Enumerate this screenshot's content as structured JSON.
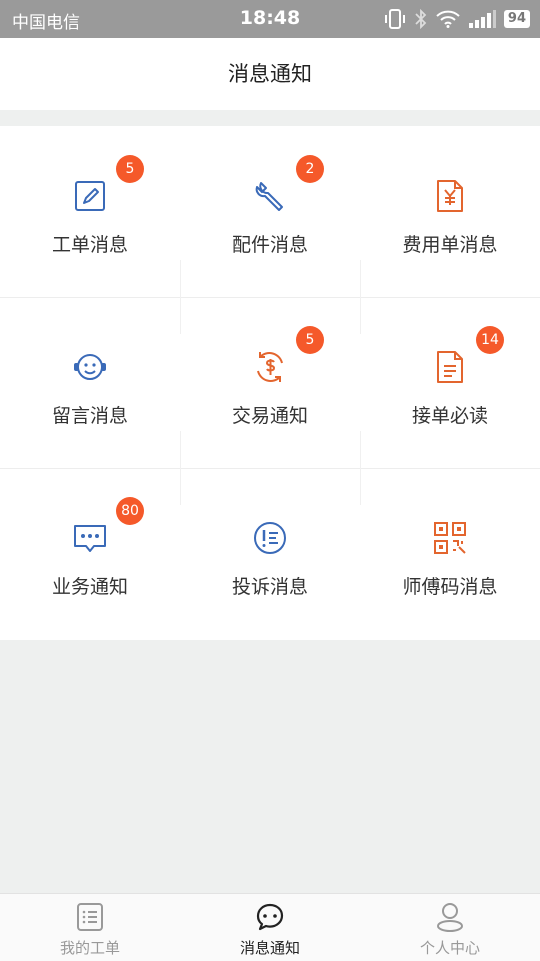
{
  "status_bar": {
    "carrier": "中国电信",
    "time": "18:48",
    "battery": "94"
  },
  "header": {
    "title": "消息通知"
  },
  "colors": {
    "accent_orange": "#e3652e",
    "accent_blue": "#3a6ab8",
    "badge": "#f5592a"
  },
  "grid": {
    "items": [
      {
        "label": "工单消息",
        "icon": "edit-icon",
        "badge": "5"
      },
      {
        "label": "配件消息",
        "icon": "wrench-icon",
        "badge": "2"
      },
      {
        "label": "费用单消息",
        "icon": "invoice-icon",
        "badge": ""
      },
      {
        "label": "留言消息",
        "icon": "customer-service-icon",
        "badge": ""
      },
      {
        "label": "交易通知",
        "icon": "money-exchange-icon",
        "badge": "5"
      },
      {
        "label": "接单必读",
        "icon": "document-icon",
        "badge": "14"
      },
      {
        "label": "业务通知",
        "icon": "chat-bubble-icon",
        "badge": "80"
      },
      {
        "label": "投诉消息",
        "icon": "complaint-icon",
        "badge": ""
      },
      {
        "label": "师傅码消息",
        "icon": "qr-code-icon",
        "badge": ""
      }
    ]
  },
  "bottom_nav": {
    "items": [
      {
        "label": "我的工单",
        "icon": "list-icon",
        "active": false
      },
      {
        "label": "消息通知",
        "icon": "message-icon",
        "active": true
      },
      {
        "label": "个人中心",
        "icon": "person-icon",
        "active": false
      }
    ]
  }
}
